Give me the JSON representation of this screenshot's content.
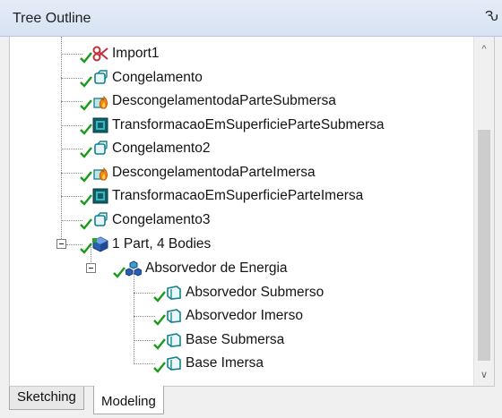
{
  "panel": {
    "title": "Tree Outline",
    "pin_glyph": "Ԅ"
  },
  "tree": {
    "items": [
      {
        "label": "Import1",
        "icon": "import-icon"
      },
      {
        "label": "Congelamento",
        "icon": "freeze-icon"
      },
      {
        "label": "DescongelamentodaParteSubmersa",
        "icon": "unfreeze-icon"
      },
      {
        "label": "TransformacaoEmSuperficieParteSubmersa",
        "icon": "surface-transform-icon"
      },
      {
        "label": "Congelamento2",
        "icon": "freeze-icon"
      },
      {
        "label": "DescongelamentodaParteImersa",
        "icon": "unfreeze-icon"
      },
      {
        "label": "TransformacaoEmSuperficieParteImersa",
        "icon": "surface-transform-icon"
      },
      {
        "label": "Congelamento3",
        "icon": "freeze-icon"
      },
      {
        "label": "1 Part, 4 Bodies",
        "icon": "part-icon"
      },
      {
        "label": "Absorvedor de Energia",
        "icon": "multibody-icon"
      },
      {
        "label": "Absorvedor Submerso",
        "icon": "surface-body-icon"
      },
      {
        "label": "Absorvedor Imerso",
        "icon": "surface-body-icon"
      },
      {
        "label": "Base Submersa",
        "icon": "surface-body-icon"
      },
      {
        "label": "Base Imersa",
        "icon": "surface-body-icon"
      }
    ]
  },
  "tabs": [
    {
      "label": "Sketching",
      "active": false
    },
    {
      "label": "Modeling",
      "active": true
    }
  ],
  "colors": {
    "check": "#1a9a1a",
    "teal": "#14808a",
    "accent_orange": "#e07a00"
  }
}
